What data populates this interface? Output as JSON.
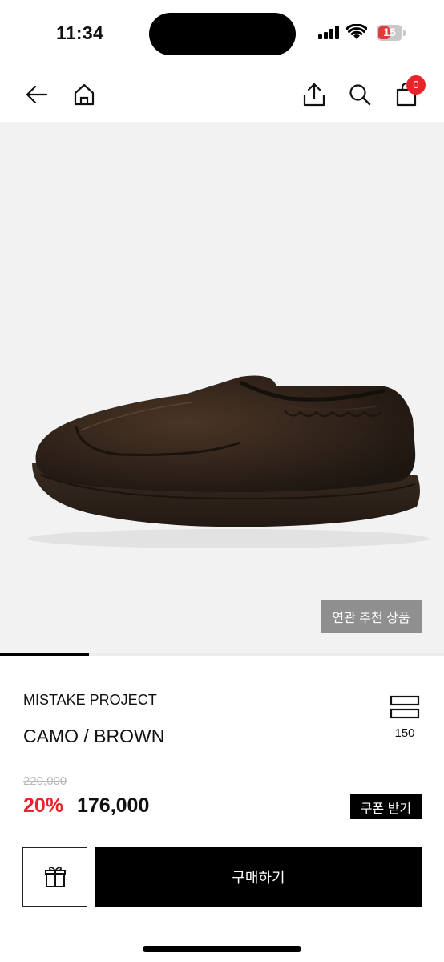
{
  "status_bar": {
    "time": "11:34",
    "battery_level": "15"
  },
  "nav": {
    "back_icon": "arrow-left-icon",
    "home_icon": "home-icon",
    "share_icon": "share-icon",
    "search_icon": "search-icon",
    "cart_icon": "shopping-bag-icon",
    "cart_count": "0"
  },
  "hero": {
    "image": "dark brown suede slip-on shoe",
    "related_button": "연관 추천 상품",
    "gallery_progress": 0.2
  },
  "product": {
    "brand": "MISTAKE PROJECT",
    "name": "CAMO / BROWN",
    "size_count": "150",
    "original_price": "220,000",
    "discount": "20%",
    "sale_price": "176,000",
    "coupon_button": "쿠폰 받기"
  },
  "footer": {
    "gift_icon": "gift-icon",
    "buy_button": "구매하기"
  },
  "colors": {
    "accent": "#e8232b",
    "primary": "#000000",
    "hero_bg": "#f2f2f2"
  }
}
